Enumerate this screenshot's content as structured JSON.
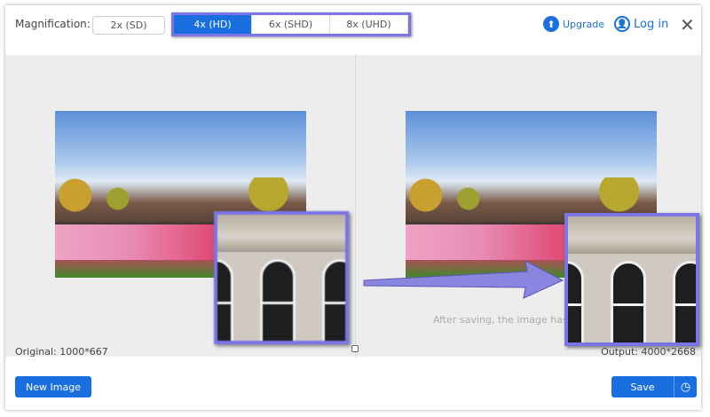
{
  "header": {
    "magnification_label": "Magnification:",
    "options": [
      {
        "label": "2x (SD)"
      },
      {
        "label": "4x (HD)",
        "selected": true
      },
      {
        "label": "6x (SHD)"
      },
      {
        "label": "8x (UHD)"
      }
    ],
    "upgrade": "Upgrade",
    "login": "Log in"
  },
  "preview": {
    "original": "Original: 1000*667",
    "output": "Output: 4000*2668",
    "hint": "After saving, the image has n"
  },
  "footer": {
    "new_image": "New Image",
    "save": "Save"
  },
  "colors": {
    "accent": "#1a6fe0",
    "highlight": "#7a74e6"
  }
}
